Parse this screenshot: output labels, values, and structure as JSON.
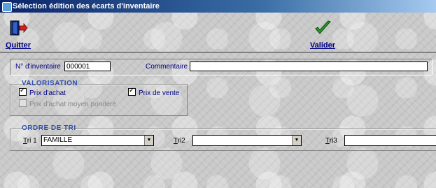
{
  "window": {
    "title": "Sélection édition des écarts d'inventaire"
  },
  "toolbar": {
    "quit_label": "Quitter",
    "validate_label": "Valider"
  },
  "inventory": {
    "number_label": "N° d'inventaire",
    "number_value": "000001",
    "comment_label": "Commentaire :",
    "comment_value": ""
  },
  "valorisation": {
    "title": "VALORISATION",
    "options": [
      {
        "label": "Prix d'achat",
        "checked": true,
        "enabled": true
      },
      {
        "label": "Prix de vente",
        "checked": true,
        "enabled": true
      },
      {
        "label": "Prix d'achat moyen pondéré",
        "checked": false,
        "enabled": false
      }
    ]
  },
  "ordre_tri": {
    "title": "ORDRE DE TRI",
    "tri1": {
      "label_prefix": "T",
      "label_rest": "ri 1",
      "value": "FAMILLE"
    },
    "tri2": {
      "label_prefix": "T",
      "label_rest": "ri2",
      "value": ""
    },
    "tri3": {
      "label_prefix": "T",
      "label_rest": "ri3",
      "value": ""
    }
  }
}
